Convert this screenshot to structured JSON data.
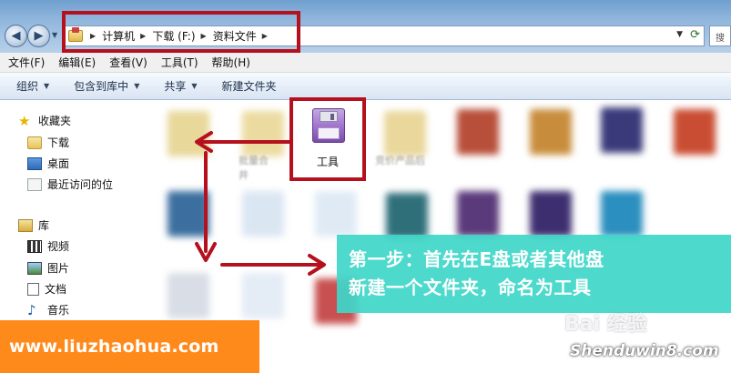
{
  "window": {
    "breadcrumb": [
      "计算机",
      "下载 (F:)",
      "资料文件"
    ],
    "search_placeholder": "搜"
  },
  "menubar": {
    "items": [
      "文件(F)",
      "编辑(E)",
      "查看(V)",
      "工具(T)",
      "帮助(H)"
    ]
  },
  "toolbar": {
    "organize": "组织",
    "include_in_library": "包含到库中",
    "share": "共享",
    "new_folder": "新建文件夹"
  },
  "navpane": {
    "favorites": "收藏夹",
    "favorites_items": [
      "下载",
      "桌面",
      "最近访问的位"
    ],
    "libraries": "库",
    "library_items": [
      "视频",
      "图片",
      "文档",
      "音乐"
    ]
  },
  "content": {
    "focused_file": {
      "name": "工具",
      "icon": "floppy-disk-icon"
    },
    "blurred_labels": [
      "批量合",
      "井",
      "竞价产品后"
    ]
  },
  "callout": {
    "line1": "第一步：首先在E盘或者其他盘",
    "line2": "新建一个文件夹，命名为工具"
  },
  "watermarks": {
    "site": "www.liuzhaohua.com",
    "baidu": "Bai 经验",
    "shendu": "Shenduwin8.com"
  },
  "colors": {
    "highlight": "#b5101d",
    "callout_bg": "#40d6c8",
    "watermark_orange": "#ff8a1c"
  }
}
